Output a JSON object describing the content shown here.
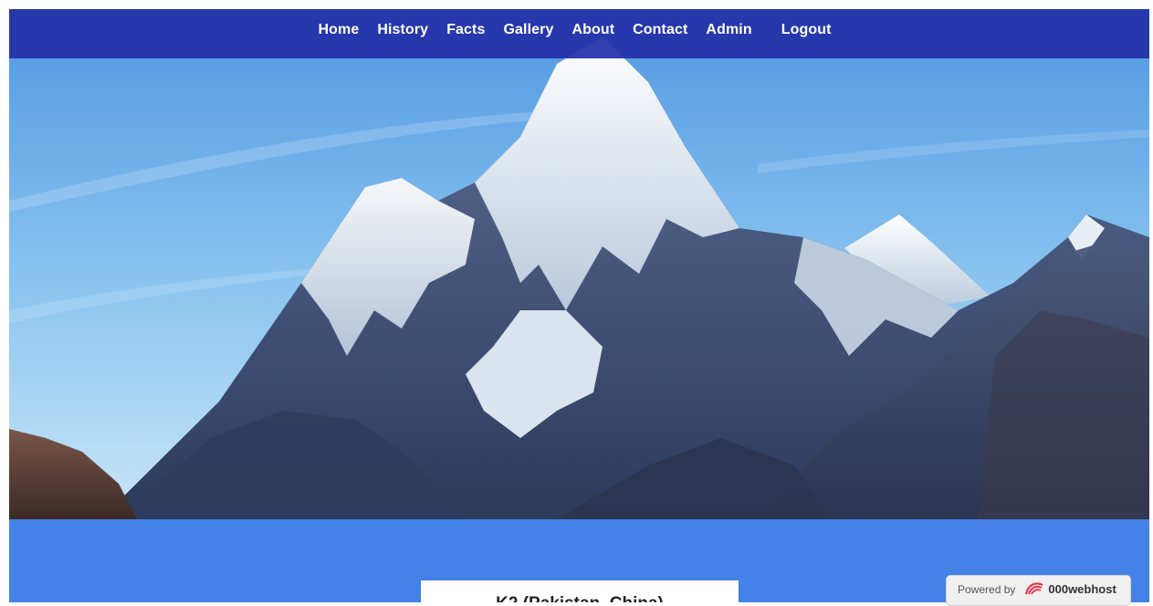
{
  "nav": {
    "items": [
      {
        "label": "Home"
      },
      {
        "label": "History"
      },
      {
        "label": "Facts"
      },
      {
        "label": "Gallery"
      },
      {
        "label": "About"
      },
      {
        "label": "Contact"
      },
      {
        "label": "Admin"
      },
      {
        "label": "Logout"
      }
    ]
  },
  "hero": {
    "image": "mountain-peak-photo"
  },
  "main": {
    "card_title": "K2 (Pakistan, China)"
  },
  "footer_badge": {
    "prefix": "Powered by",
    "brand": "000webhost",
    "icon": "000webhost-logo-icon"
  },
  "colors": {
    "nav_bg": "#2430a8",
    "content_bg": "#4582e8",
    "sky_top": "#5aa2e6",
    "sky_bottom": "#bfe0f6"
  }
}
